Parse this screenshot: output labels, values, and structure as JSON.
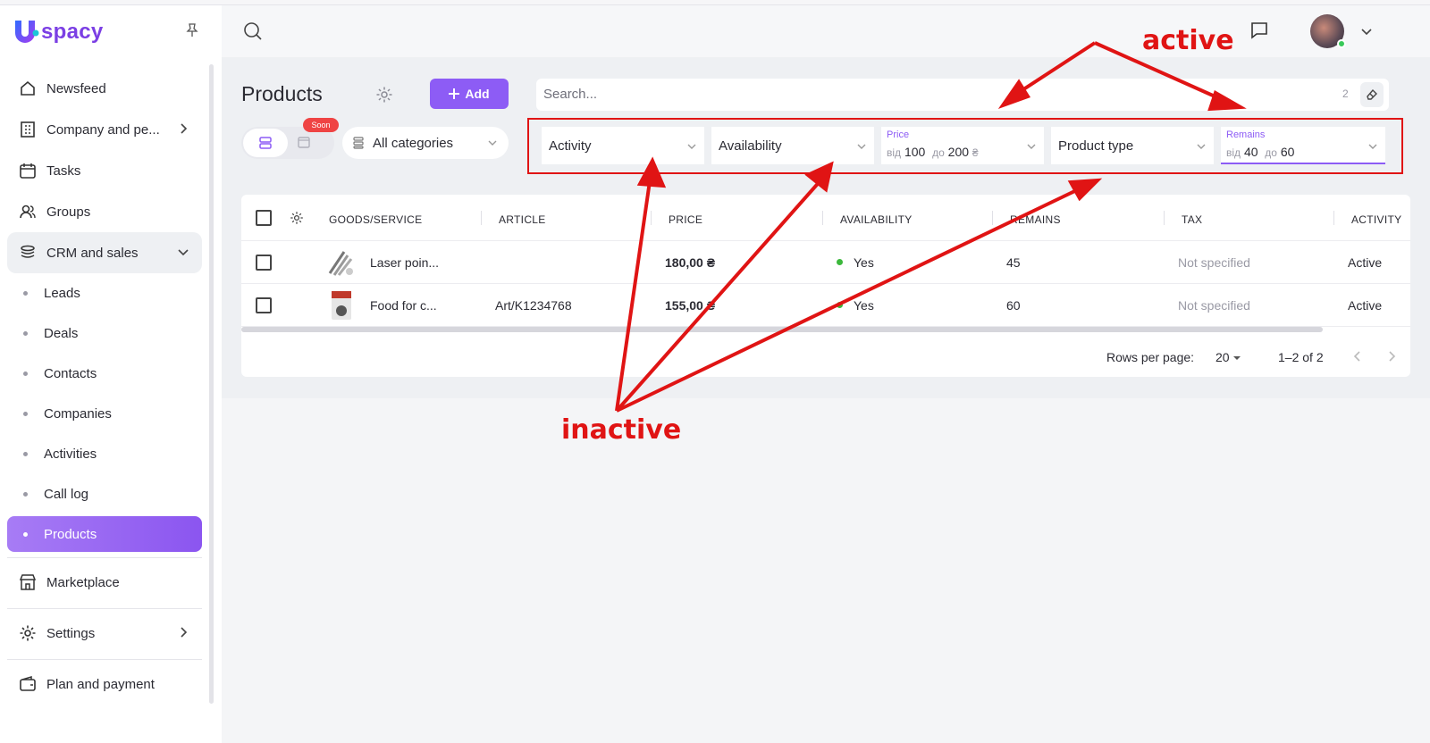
{
  "brand": {
    "logo_text": "spacy"
  },
  "sidebar": {
    "items": [
      {
        "label": "Newsfeed",
        "icon": "home-icon"
      },
      {
        "label": "Company and pe...",
        "icon": "building-icon"
      },
      {
        "label": "Tasks",
        "icon": "calendar-check-icon"
      },
      {
        "label": "Groups",
        "icon": "users-icon"
      },
      {
        "label": "CRM and sales",
        "icon": "stack-icon"
      }
    ],
    "crm_sub": [
      "Leads",
      "Deals",
      "Contacts",
      "Companies",
      "Activities",
      "Call log",
      "Products"
    ],
    "bottom": [
      {
        "label": "Marketplace",
        "icon": "store-icon"
      },
      {
        "label": "Settings",
        "icon": "gear-icon"
      },
      {
        "label": "Plan and payment",
        "icon": "wallet-icon"
      }
    ]
  },
  "toolbar": {
    "title": "Products",
    "add_label": "Add",
    "search_placeholder": "Search...",
    "search_count": "2",
    "soon_badge": "Soon",
    "categories_label": "All categories"
  },
  "filters": {
    "activity": "Activity",
    "availability": "Availability",
    "price_label": "Price",
    "price_from_prefix": "від",
    "price_from": "100",
    "price_to_prefix": "до",
    "price_to": "200",
    "price_currency": "₴",
    "product_type": "Product type",
    "remains_label": "Remains",
    "remains_from_prefix": "від",
    "remains_from": "40",
    "remains_to_prefix": "до",
    "remains_to": "60"
  },
  "table": {
    "headers": [
      "GOODS/SERVICE",
      "ARTICLE",
      "PRICE",
      "AVAILABILITY",
      "REMAINS",
      "TAX",
      "ACTIVITY"
    ],
    "rows": [
      {
        "name": "Laser poin...",
        "article": "",
        "price": "180,00 ₴",
        "availability": "Yes",
        "remains": "45",
        "tax": "Not specified",
        "activity": "Active"
      },
      {
        "name": "Food for c...",
        "article": "Art/K1234768",
        "price": "155,00 ₴",
        "availability": "Yes",
        "remains": "60",
        "tax": "Not specified",
        "activity": "Active"
      }
    ],
    "rows_per_page_label": "Rows per page:",
    "rows_per_page": "20",
    "range": "1–2 of 2"
  },
  "annotations": {
    "active": "active",
    "inactive": "inactive"
  },
  "colors": {
    "accent": "#8d5cf5",
    "annotation": "#e01414",
    "status_ok": "#3cb83c"
  }
}
